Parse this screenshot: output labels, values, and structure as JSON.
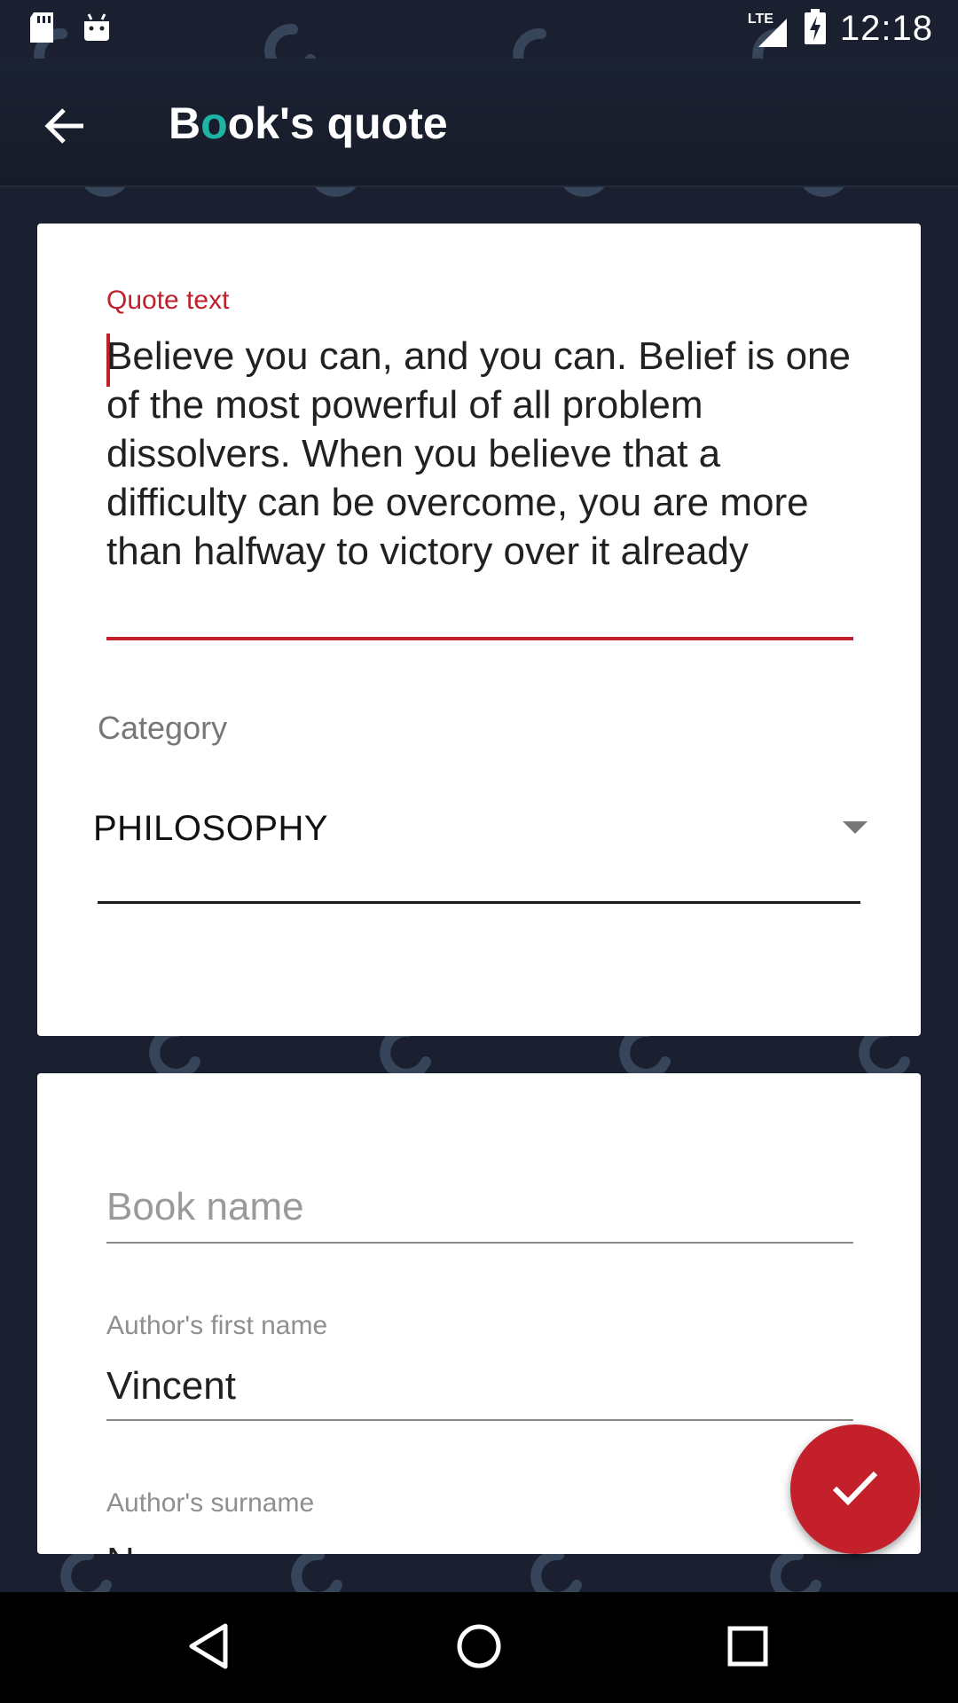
{
  "status_bar": {
    "time": "12:18",
    "network_label": "LTE",
    "icons": [
      "sd-card-icon",
      "android-icon",
      "signal-icon",
      "battery-charging-icon"
    ]
  },
  "app_bar": {
    "title_prefix": "B",
    "title_accent": "o",
    "title_suffix": "ok's quote",
    "back_icon": "arrow-back-icon"
  },
  "quote_card": {
    "quote_label": "Quote text",
    "quote_value": "Believe you can, and you can. Belief is one of the most powerful of all problem dissolvers. When you believe that a difficulty can be overcome, you are more than halfway to victory over it already",
    "category_label": "Category",
    "category_value": "PHILOSOPHY"
  },
  "book_card": {
    "book_name_placeholder": "Book name",
    "first_name_label": "Author's first name",
    "first_name_value": "Vincent",
    "surname_label": "Author's surname",
    "surname_value": "N"
  },
  "fab": {
    "icon": "check-icon"
  },
  "nav_bar": {
    "icons": [
      "back-triangle-icon",
      "home-circle-icon",
      "recents-square-icon"
    ]
  },
  "colors": {
    "background": "#1b2030",
    "accent_red": "#c0202b",
    "title_accent": "#1fb3a6",
    "card": "#ffffff"
  }
}
